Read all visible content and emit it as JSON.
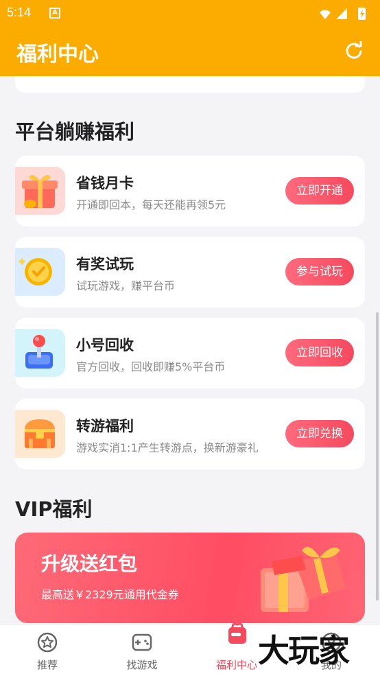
{
  "status_bar": {
    "time": "5:14",
    "a_icon": "A"
  },
  "app_bar": {
    "title": "福利中心",
    "refresh_icon": "refresh-icon"
  },
  "sections": {
    "platform_title": "平台躺赚福利",
    "vip_title": "VIP福利"
  },
  "cards": [
    {
      "name": "省钱月卡",
      "desc": "开通即回本，每天还能再领5元",
      "button": "立即开通",
      "icon": "gift-box-icon"
    },
    {
      "name": "有奖试玩",
      "desc": "试玩游戏，赚平台币",
      "button": "参与试玩",
      "icon": "coin-icon"
    },
    {
      "name": "小号回收",
      "desc": "官方回收，回收即赚5%平台币",
      "button": "立即回收",
      "icon": "joystick-icon"
    },
    {
      "name": "转游福利",
      "desc": "游戏实消1:1产生转游点，换新游豪礼",
      "button": "立即兑换",
      "icon": "treasure-chest-icon"
    }
  ],
  "vip_banner": {
    "title": "升级送红包",
    "subtitle": "最高送￥2329元通用代金券"
  },
  "tabs": [
    {
      "label": "推荐",
      "icon": "star-icon"
    },
    {
      "label": "找游戏",
      "icon": "gamepad-icon"
    },
    {
      "label": "福利中心",
      "icon": "gift-icon"
    },
    {
      "label": "我的",
      "icon": "profile-icon"
    }
  ],
  "watermark": "大玩家",
  "colors": {
    "brand": "#fcac00",
    "accent": "#f5495e"
  }
}
